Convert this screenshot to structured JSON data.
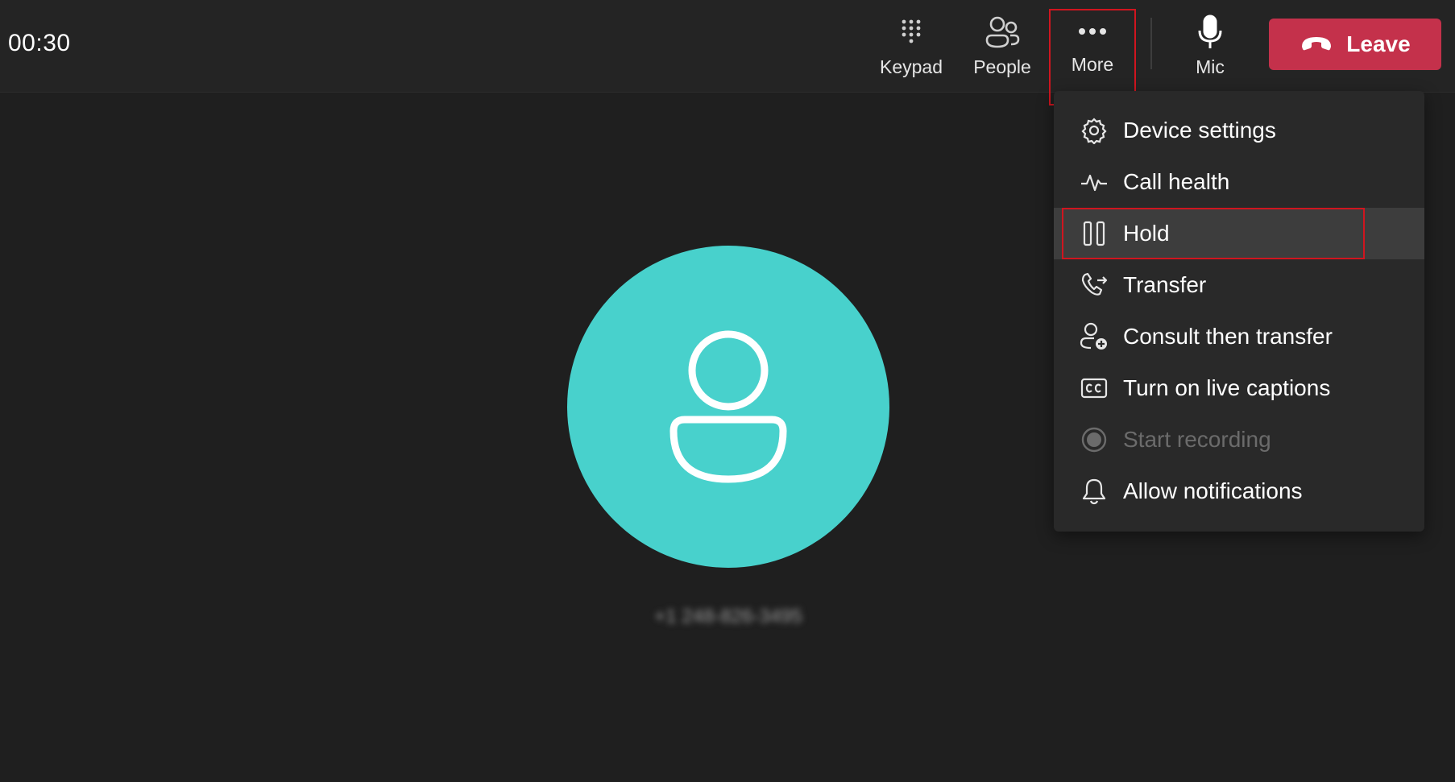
{
  "call": {
    "timer": "00:30",
    "caller_number": "+1 248-826-3495"
  },
  "toolbar": {
    "keypad_label": "Keypad",
    "people_label": "People",
    "more_label": "More",
    "mic_label": "Mic",
    "leave_label": "Leave"
  },
  "menu": {
    "items": [
      {
        "label": "Device settings",
        "icon": "gear-icon"
      },
      {
        "label": "Call health",
        "icon": "pulse-icon"
      },
      {
        "label": "Hold",
        "icon": "pause-icon"
      },
      {
        "label": "Transfer",
        "icon": "phone-transfer-icon"
      },
      {
        "label": "Consult then transfer",
        "icon": "person-add-icon"
      },
      {
        "label": "Turn on live captions",
        "icon": "closed-captions-icon"
      },
      {
        "label": "Start recording",
        "icon": "record-icon"
      },
      {
        "label": "Allow notifications",
        "icon": "bell-icon"
      }
    ]
  },
  "colors": {
    "background": "#1f1f1f",
    "topbar": "#242424",
    "leave_button": "#c4314b",
    "avatar": "#48d1cc",
    "accent_underline": "#7f85f5",
    "menu_background": "#292929",
    "highlight_outline": "#d0151f"
  }
}
